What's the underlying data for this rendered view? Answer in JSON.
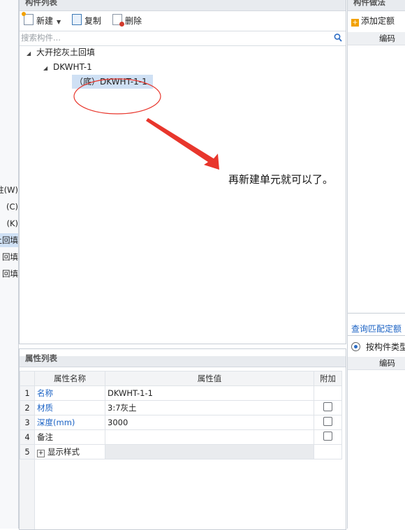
{
  "left_panel": {
    "items": [
      {
        "label": "柱(W)"
      },
      {
        "label": "(C)"
      },
      {
        "label": "(K)"
      },
      {
        "label": "土回填",
        "selected": true
      },
      {
        "label": "回填"
      },
      {
        "label": "回填"
      }
    ]
  },
  "component_list": {
    "title": "构件列表",
    "toolbar": {
      "new_label": "新建",
      "copy_label": "复制",
      "delete_label": "删除"
    },
    "search": {
      "placeholder": "搜索构件...",
      "value": ""
    },
    "tree": {
      "root": "大开挖灰土回填",
      "child": "DKWHT-1",
      "leaf": "（底）DKWHT-1-1"
    },
    "annotation": "再新建单元就可以了。",
    "annotation_color": "#e8362c"
  },
  "property_list": {
    "title": "属性列表",
    "columns": [
      "属性名称",
      "属性值",
      "附加"
    ],
    "rows": [
      {
        "num": "1",
        "name": "名称",
        "value": "DKWHT-1-1"
      },
      {
        "num": "2",
        "name": "材质",
        "value": "3:7灰土"
      },
      {
        "num": "3",
        "name": "深度(mm)",
        "value": "3000"
      },
      {
        "num": "4",
        "name": "备注",
        "value": ""
      },
      {
        "num": "5",
        "name": "显示样式",
        "value": ""
      }
    ]
  },
  "right_panel": {
    "title": "构件做法",
    "add_quota_label": "添加定额",
    "code_header": "编码",
    "query_tab": "查询匹配定额",
    "radio_label": "按构件类型",
    "code_header_2": "编码"
  },
  "colors": {
    "selection": "#cfe0f4",
    "link_blue": "#1a62c4",
    "annotation_red": "#e8362c"
  }
}
